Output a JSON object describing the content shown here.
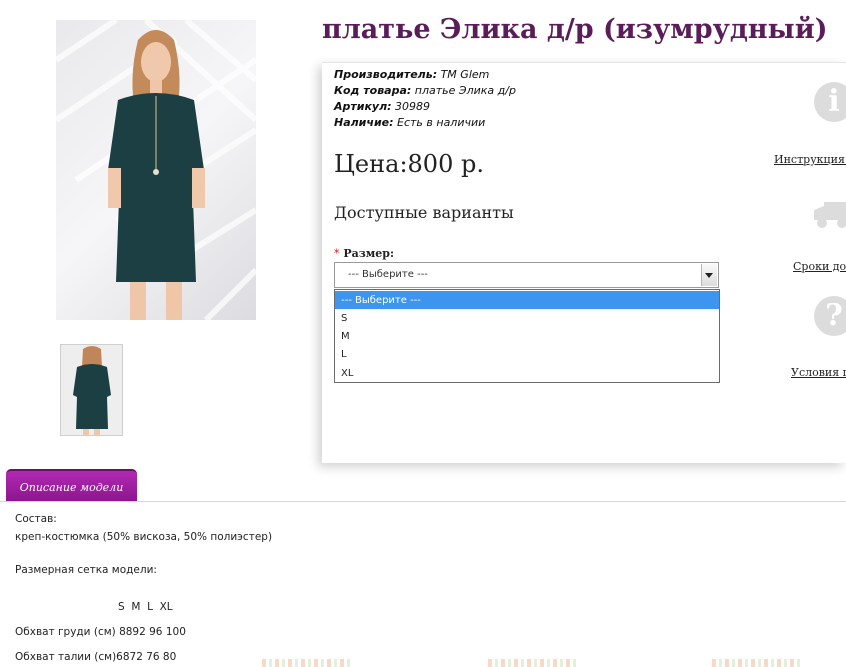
{
  "product": {
    "title": "платье Элика д/р (изумрудный)",
    "manufacturer_label": "Производитель:",
    "manufacturer_value": " TM Glem",
    "code_label": "Код товара:",
    "code_value": " платье Элика д/р",
    "sku_label": "Артикул:",
    "sku_value": " 30989",
    "stock_label": "Наличие:",
    "stock_value": " Есть в наличии",
    "price": "Цена:800 р.",
    "variants_heading": "Доступные варианты",
    "size_required": "*",
    "size_label": " Размер:",
    "size_selected": "--- Выберите ---",
    "size_options": [
      "--- Выберите ---",
      "S",
      "M",
      "L",
      "XL"
    ]
  },
  "side": {
    "instruction_link": "Инструкция п",
    "delivery_link": "Сроки дос",
    "terms_link": "Условия п",
    "info_glyph": "i",
    "question_glyph": "?"
  },
  "colors": {
    "title": "#5a1d59",
    "tab": "#9c1d9c",
    "dropdown_highlight": "#3e95ef",
    "dress": "#1b3f43"
  },
  "description": {
    "tab_label": "Описание модели",
    "composition_label": "Состав:",
    "composition_value": "креп-костюмка (50% вискоза, 50% полиэстер)",
    "size_chart_label": "Размерная сетка модели:",
    "size_header": "S  M  L  XL",
    "chest_row": "Обхват груди (см) 8892 96 100",
    "waist_row": "Обхват талии (см)6872 76 80"
  }
}
